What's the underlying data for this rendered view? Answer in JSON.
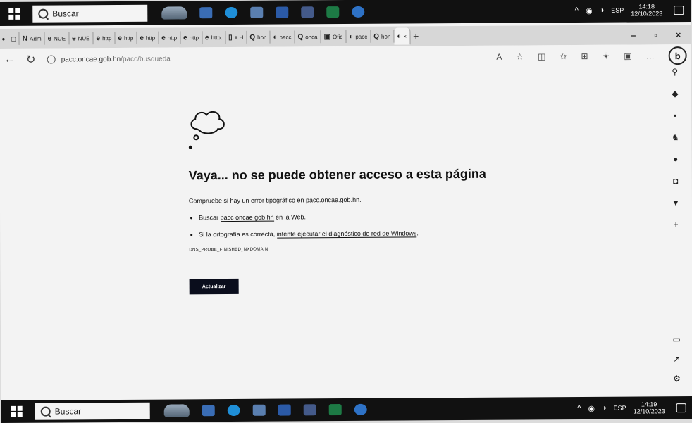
{
  "taskbar_top": {
    "search": "Buscar",
    "tray_lang": "ESP",
    "time": "14:18",
    "date": "12/10/2023"
  },
  "taskbar_bottom": {
    "search": "Buscar",
    "tray_lang": "ESP",
    "time": "14:19",
    "date": "12/10/2023"
  },
  "tabs": [
    {
      "icon": "N",
      "label": "Adm"
    },
    {
      "icon": "e",
      "label": "NUE"
    },
    {
      "icon": "e",
      "label": "NUE"
    },
    {
      "icon": "e",
      "label": "http"
    },
    {
      "icon": "e",
      "label": "http"
    },
    {
      "icon": "e",
      "label": "http"
    },
    {
      "icon": "e",
      "label": "http"
    },
    {
      "icon": "e",
      "label": "http"
    },
    {
      "icon": "e",
      "label": "http."
    },
    {
      "icon": "▯",
      "label": "≡ H"
    },
    {
      "icon": "Q",
      "label": "hon"
    },
    {
      "icon": "◐",
      "label": "pacc"
    },
    {
      "icon": "Q",
      "label": "onca"
    },
    {
      "icon": "▣",
      "label": "Ofic"
    },
    {
      "icon": "◐",
      "label": "pacc"
    },
    {
      "icon": "Q",
      "label": "hon"
    }
  ],
  "active_tab": {
    "label": "×"
  },
  "address": {
    "host": "pacc.oncae.gob.hn",
    "path": "/pacc/busqueda"
  },
  "error": {
    "title": "Vaya... no se puede obtener acceso a esta página",
    "check": "Compruebe si hay un error tipográfico en pacc.oncae.gob.hn.",
    "b1_pre": "Buscar ",
    "b1_link": "pacc oncae gob hn",
    "b1_post": " en la Web.",
    "b2_pre": "Si la ortografía es correcta, ",
    "b2_link": "intente ejecutar el diagnóstico de red de Windows",
    "b2_post": ".",
    "code": "DNS_PROBE_FINISHED_NXDOMAIN",
    "button": "Actualizar"
  },
  "colors": {
    "taskbar": "#111111",
    "button": "#0a0d1c",
    "page": "#f3f3f3"
  }
}
